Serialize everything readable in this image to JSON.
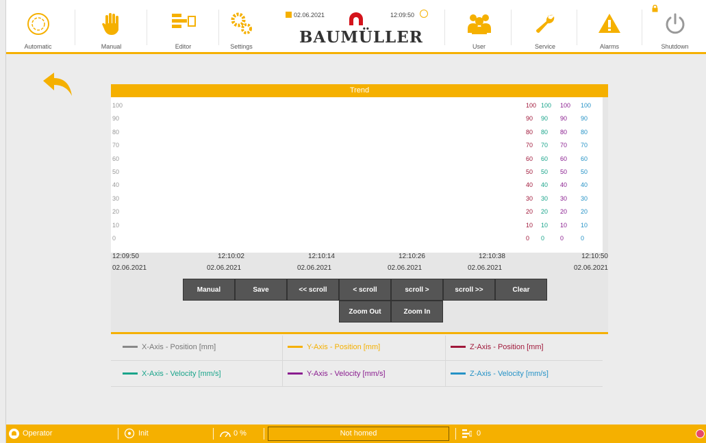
{
  "header": {
    "nav_left": [
      {
        "label": "Automatic",
        "icon": "automatic-icon"
      },
      {
        "label": "Manual",
        "icon": "hand-icon"
      },
      {
        "label": "Editor",
        "icon": "editor-icon"
      },
      {
        "label": "Settings",
        "icon": "gears-icon"
      }
    ],
    "nav_right": [
      {
        "label": "User",
        "icon": "users-icon"
      },
      {
        "label": "Service",
        "icon": "wrench-icon"
      },
      {
        "label": "Alarms",
        "icon": "warning-icon"
      },
      {
        "label": "Shutdown",
        "icon": "power-icon"
      }
    ],
    "date": "02.06.2021",
    "time": "12:09:50",
    "brand": "BAUMÜLLER",
    "accent_color": "#f5b000"
  },
  "trend": {
    "title": "Trend",
    "y_ticks": [
      "100",
      "90",
      "80",
      "70",
      "60",
      "50",
      "40",
      "30",
      "20",
      "10",
      "0"
    ],
    "right_axes": [
      {
        "color": "#a0183a",
        "ticks": [
          "100",
          "90",
          "80",
          "70",
          "60",
          "50",
          "40",
          "30",
          "20",
          "10",
          "0"
        ]
      },
      {
        "color": "#19a48a",
        "ticks": [
          "100",
          "90",
          "80",
          "70",
          "60",
          "50",
          "40",
          "30",
          "20",
          "10",
          "0"
        ]
      },
      {
        "color": "#8a1d8f",
        "ticks": [
          "100",
          "90",
          "80",
          "70",
          "60",
          "50",
          "40",
          "30",
          "20",
          "10",
          "0"
        ]
      },
      {
        "color": "#2592c6",
        "ticks": [
          "100",
          "90",
          "80",
          "70",
          "60",
          "50",
          "40",
          "30",
          "20",
          "10",
          "0"
        ]
      }
    ],
    "x_labels": [
      {
        "time": "12:09:50",
        "date": "02.06.2021"
      },
      {
        "time": "12:10:02",
        "date": "02.06.2021"
      },
      {
        "time": "12:10:14",
        "date": "02.06.2021"
      },
      {
        "time": "12:10:26",
        "date": "02.06.2021"
      },
      {
        "time": "12:10:38",
        "date": "02.06.2021"
      },
      {
        "time": "12:10:50",
        "date": "02.06.2021"
      }
    ],
    "buttons_row1": [
      "Manual",
      "Save",
      "<< scroll",
      "< scroll",
      "scroll >",
      "scroll >>",
      "Clear"
    ],
    "buttons_row2": [
      "Zoom Out",
      "Zoom In"
    ]
  },
  "legend": [
    {
      "label": "X-Axis - Position [mm]",
      "color": "#888888"
    },
    {
      "label": "Y-Axis - Position [mm]",
      "color": "#f5b000"
    },
    {
      "label": "Z-Axis - Position [mm]",
      "color": "#a0183a"
    },
    {
      "label": "X-Axis - Velocity [mm/s]",
      "color": "#19a48a"
    },
    {
      "label": "Y-Axis - Velocity [mm/s]",
      "color": "#8a1d8f"
    },
    {
      "label": "Z-Axis - Velocity [mm/s]",
      "color": "#2592c6"
    }
  ],
  "status": {
    "user": "Operator",
    "mode": "Init",
    "speed": "0 %",
    "homing": "Not homed",
    "program_count": "0"
  }
}
